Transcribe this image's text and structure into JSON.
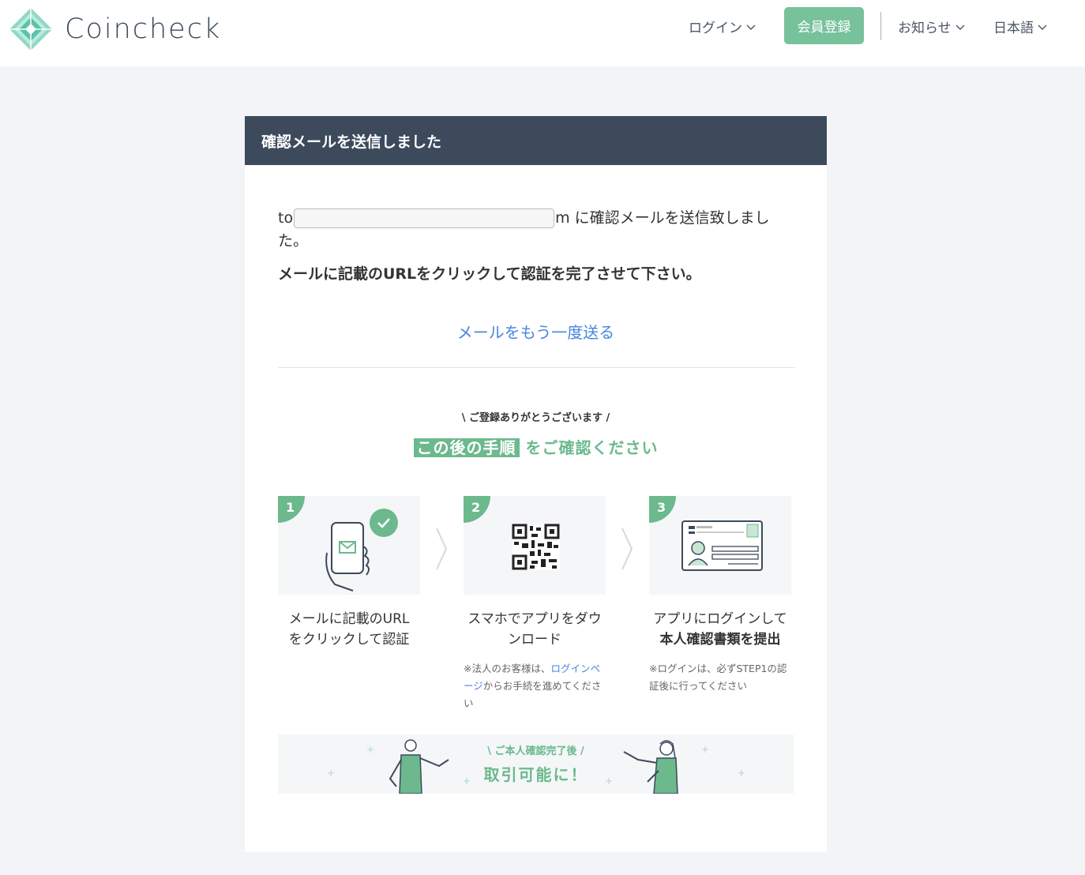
{
  "header": {
    "brand": "Coincheck",
    "nav": {
      "login": "ログイン",
      "register": "会員登録",
      "news": "お知らせ",
      "language": "日本語"
    }
  },
  "card": {
    "title": "確認メールを送信しました",
    "email_prefix": "to",
    "email_suffix": "m",
    "sent_message": "に確認メールを送信致しました。",
    "instruction": "メールに記載のURLをクリックして認証を完了させて下さい。",
    "resend_link": "メールをもう一度送る",
    "thanks": "\\ ご登録ありがとうございます /",
    "next_steps_highlight": "この後の手順",
    "next_steps_rest": "をご確認ください",
    "steps": [
      {
        "number": "1",
        "title_line1": "メールに記載のURL",
        "title_line2": "をクリックして認証"
      },
      {
        "number": "2",
        "title": "スマホでアプリをダウンロード",
        "note_prefix": "※法人のお客様は、",
        "note_link": "ログインページ",
        "note_suffix": "からお手続を進めてください"
      },
      {
        "number": "3",
        "title_line1": "アプリにログインして",
        "title_line2": "本人確認書類を提出",
        "note": "※ログインは、必ずSTEP1の認証後に行ってください"
      }
    ],
    "banner": {
      "subtitle": "\\ ご本人確認完了後 /",
      "main": "取引可能に！"
    }
  },
  "colors": {
    "accent_green": "#6cb98d",
    "header_dark": "#3c4a5c",
    "link_blue": "#4a86de"
  }
}
